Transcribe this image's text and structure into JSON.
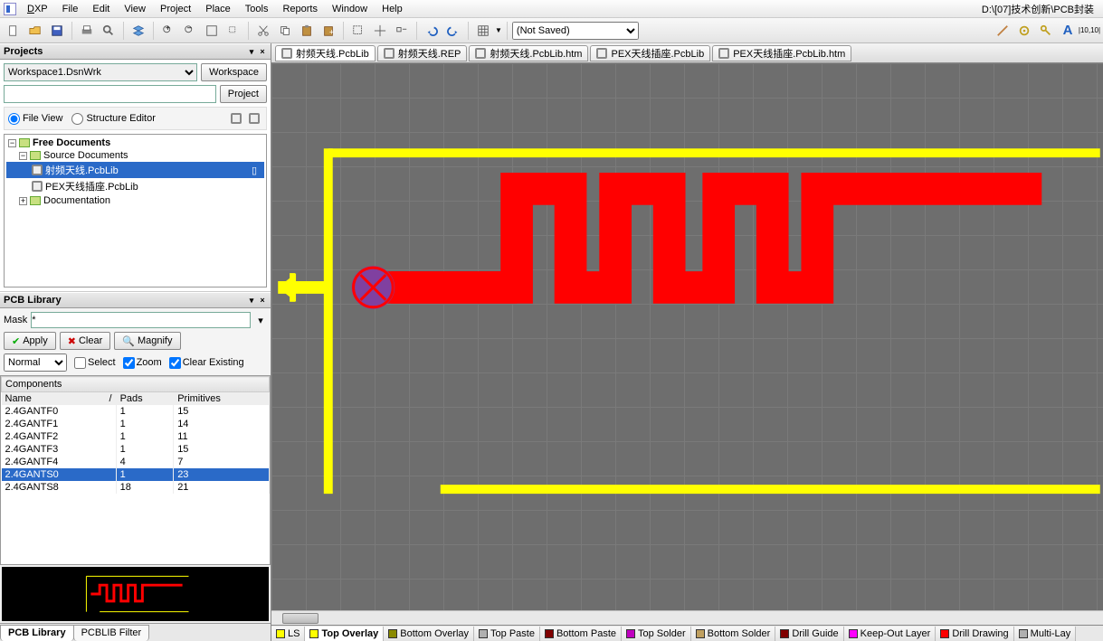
{
  "title_path": "D:\\[07]技术创新\\PCB封装",
  "menu": [
    "DXP",
    "File",
    "Edit",
    "View",
    "Project",
    "Place",
    "Tools",
    "Reports",
    "Window",
    "Help"
  ],
  "toolbar_select": "(Not Saved)",
  "projects": {
    "title": "Projects",
    "workspace": "Workspace1.DsnWrk",
    "workspace_btn": "Workspace",
    "project_btn": "Project",
    "file_view": "File View",
    "structure_editor": "Structure Editor",
    "tree": {
      "root": "Free Documents",
      "src": "Source Documents",
      "f1": "射频天线.PcbLib",
      "f2": "PEX天线插座.PcbLib",
      "doc": "Documentation"
    }
  },
  "library": {
    "title": "PCB Library",
    "mask_label": "Mask",
    "mask_value": "*",
    "apply": "Apply",
    "clear": "Clear",
    "magnify": "Magnify",
    "normal": "Normal",
    "select": "Select",
    "zoom": "Zoom",
    "clear_existing": "Clear Existing",
    "components_hdr": "Components",
    "cols": {
      "name": "Name",
      "pads": "Pads",
      "primitives": "Primitives"
    },
    "rows": [
      {
        "n": "2.4GANTF0",
        "p": "1",
        "pr": "15"
      },
      {
        "n": "2.4GANTF1",
        "p": "1",
        "pr": "14"
      },
      {
        "n": "2.4GANTF2",
        "p": "1",
        "pr": "11"
      },
      {
        "n": "2.4GANTF3",
        "p": "1",
        "pr": "15"
      },
      {
        "n": "2.4GANTF4",
        "p": "4",
        "pr": "7"
      },
      {
        "n": "2.4GANTS0",
        "p": "1",
        "pr": "23"
      },
      {
        "n": "2.4GANTS8",
        "p": "18",
        "pr": "21"
      }
    ],
    "tab1": "PCB Library",
    "tab2": "PCBLIB Filter"
  },
  "doctabs": [
    "射频天线.PcbLib",
    "射频天线.REP",
    "射频天线.PcbLib.htm",
    "PEX天线插座.PcbLib",
    "PEX天线插座.PcbLib.htm"
  ],
  "layers": [
    {
      "label": "LS",
      "color": "#ffff00"
    },
    {
      "label": "Top Overlay",
      "color": "#ffff00",
      "active": true
    },
    {
      "label": "Bottom Overlay",
      "color": "#8a8a00"
    },
    {
      "label": "Top Paste",
      "color": "#b0b0b0"
    },
    {
      "label": "Bottom Paste",
      "color": "#800000"
    },
    {
      "label": "Top Solder",
      "color": "#c000c0"
    },
    {
      "label": "Bottom Solder",
      "color": "#c0a060"
    },
    {
      "label": "Drill Guide",
      "color": "#800000"
    },
    {
      "label": "Keep-Out Layer",
      "color": "#ff00ff"
    },
    {
      "label": "Drill Drawing",
      "color": "#ff0000"
    },
    {
      "label": "Multi-Lay",
      "color": "#b0b0b0"
    }
  ]
}
